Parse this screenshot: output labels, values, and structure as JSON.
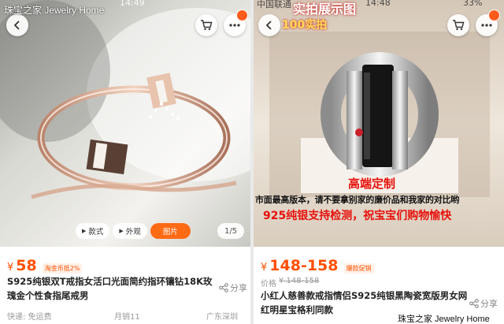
{
  "watermark": {
    "top_left": "珠宝之家  Jewelry Home",
    "bottom_right": "珠宝之家  Jewelry Home"
  },
  "left": {
    "status_time": "14:49",
    "media_chips": [
      "款式",
      "外观",
      "图片"
    ],
    "image_counter": "1/5",
    "price_symbol": "¥",
    "price": "58",
    "price_tag": "淘金币抵2%",
    "title": "S925纯银双T戒指女活口光面简约指环镶钻18K玫瑰金个性食指尾戒男",
    "share_label": "分享",
    "shipping": "快递: 免运费",
    "monthly_sales": "月销11",
    "location": "广东深圳"
  },
  "right": {
    "status_carrier": "中国联通",
    "status_time": "14:48",
    "status_battery": "33%",
    "banner_line1": "实拍展示图",
    "banner_line2": "100实拍",
    "overlay_red1": "高端定制",
    "overlay_black": "市面最高版本，请不要拿别家的廉价品和我家的对比哟",
    "overlay_red2": "925纯银支持检测，祝宝宝们购物愉快",
    "price_symbol": "¥",
    "price": "148-158",
    "price_tag": "爆款促销",
    "orig_label": "价格",
    "orig_price": "¥ 148-158",
    "title": "小红人慈善款戒指情侣S925纯银黑陶瓷宽版男女网红明星宝格利同款",
    "share_label": "分享"
  },
  "colors": {
    "price": "#ff5000",
    "accent_orange": "#ff6a14",
    "overlay_red": "#e8100b"
  }
}
